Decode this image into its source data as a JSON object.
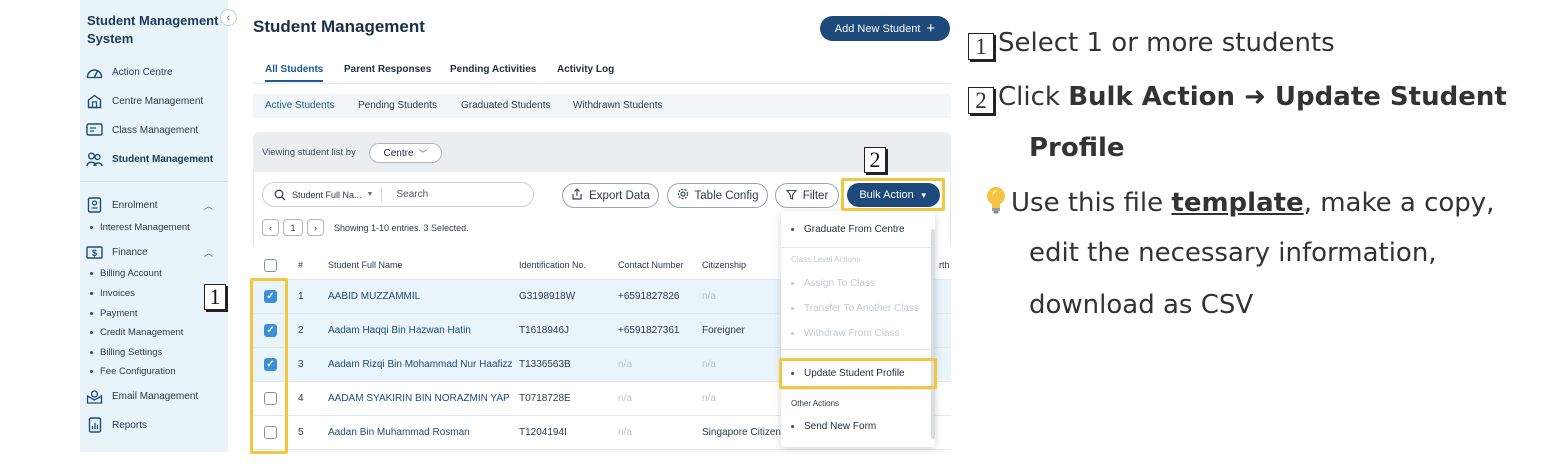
{
  "sidebar": {
    "title": "Student Management System",
    "items": [
      {
        "label": "Action Centre",
        "icon": "gauge-icon"
      },
      {
        "label": "Centre Management",
        "icon": "building-icon"
      },
      {
        "label": "Class Management",
        "icon": "class-icon"
      },
      {
        "label": "Student Management",
        "icon": "students-icon",
        "active": true
      },
      {
        "label": "Enrolment",
        "icon": "enrolment-icon"
      },
      {
        "label": "Finance",
        "icon": "finance-icon"
      },
      {
        "label": "Email Management",
        "icon": "email-icon"
      },
      {
        "label": "Reports",
        "icon": "reports-icon"
      }
    ],
    "enrolment_sub": [
      "Interest Management"
    ],
    "finance_sub": [
      "Billing Account",
      "Invoices",
      "Payment",
      "Credit Management",
      "Billing Settings",
      "Fee Configuration"
    ]
  },
  "header": {
    "title": "Student Management",
    "add_button": "Add New Student"
  },
  "tabs": [
    "All Students",
    "Parent Responses",
    "Pending Activities",
    "Activity Log"
  ],
  "subtabs": [
    "Active Students",
    "Pending Students",
    "Graduated Students",
    "Withdrawn Students"
  ],
  "viewbar": {
    "label": "Viewing student list by",
    "selected": "Centre"
  },
  "toolbar": {
    "search_field": "Student Full Na...",
    "search_placeholder": "Search",
    "export_label": "Export Data",
    "table_config_label": "Table Config",
    "filter_label": "Filter",
    "bulk_label": "Bulk Action"
  },
  "pager": {
    "page": "1",
    "text": "Showing 1-10 entries. 3 Selected."
  },
  "table": {
    "columns": [
      "#",
      "Student Full Name",
      "Identification No.",
      "Contact Number",
      "Citizenship",
      "rth"
    ],
    "rows": [
      {
        "n": "1",
        "name": "AABID MUZZAMMIL",
        "id": "G3198918W",
        "contact": "+6591827826",
        "cit": "n/a",
        "checked": true
      },
      {
        "n": "2",
        "name": "Aadam Haqqi Bin Hazwan Hatin",
        "id": "T1618946J",
        "contact": "+6591827361",
        "cit": "Foreigner",
        "checked": true
      },
      {
        "n": "3",
        "name": "Aadam Rizqi Bin Mohammad Nur Haafizz",
        "id": "T1336563B",
        "contact": "n/a",
        "cit": "n/a",
        "checked": true
      },
      {
        "n": "4",
        "name": "AADAM SYAKIRIN BIN NORAZMIN YAP",
        "id": "T0718728E",
        "contact": "n/a",
        "cit": "n/a",
        "checked": false
      },
      {
        "n": "5",
        "name": "Aadan Bin Muhammad Rosman",
        "id": "T1204194I",
        "contact": "n/a",
        "cit": "Singapore Citizen",
        "checked": false
      }
    ]
  },
  "dropdown": {
    "item_graduate": "Graduate From Centre",
    "class_header": "Class Level Actions",
    "class_items": [
      "Assign To Class",
      "Transfer To Another Class",
      "Withdraw From Class"
    ],
    "item_update": "Update Student Profile",
    "other_header": "Other Actions",
    "item_send": "Send New Form"
  },
  "markers": {
    "one": "1",
    "two": "2"
  },
  "instructions": {
    "step1": "Select 1 or more students",
    "step2_prefix": "Click ",
    "step2_bold": "Bulk Action ➜ Update Student",
    "step2_cont": "Profile",
    "tip_prefix": "Use this file ",
    "tip_link": "template",
    "tip_suffix": ", make a copy,",
    "tip_line2": "edit the necessary information,",
    "tip_line3": "download as CSV"
  },
  "colors": {
    "primary": "#1d4a7a",
    "highlight": "#f3c63f",
    "sidebar_bg": "#e9f3fa"
  }
}
